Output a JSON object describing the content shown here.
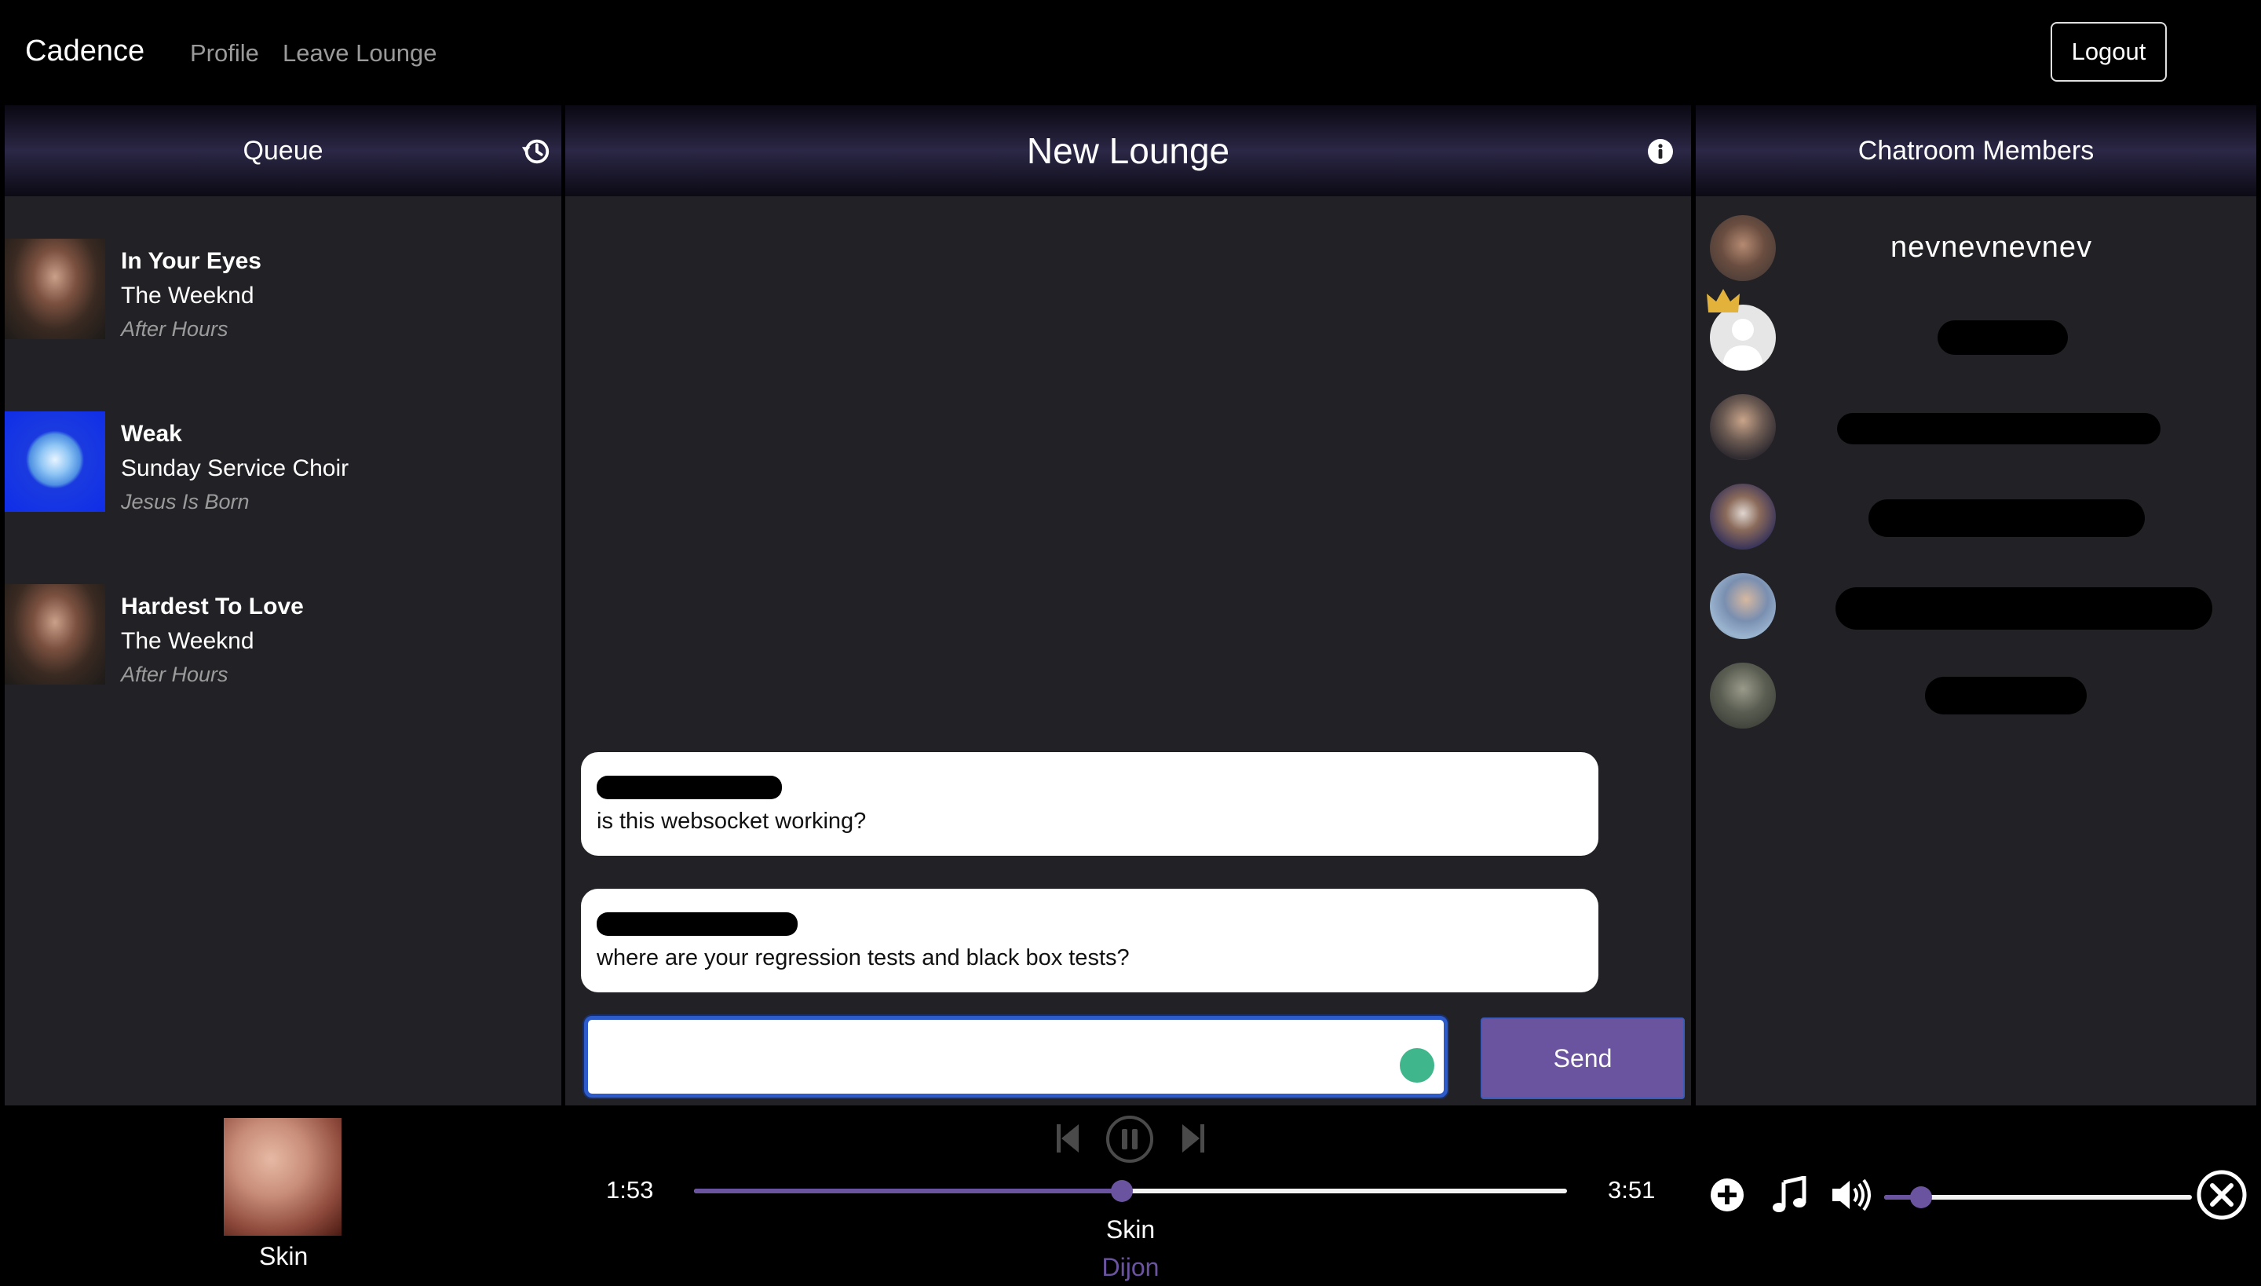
{
  "nav": {
    "brand": "Cadence",
    "profile": "Profile",
    "leave_lounge": "Leave Lounge",
    "logout": "Logout"
  },
  "queue": {
    "title": "Queue",
    "history_icon": "history-icon",
    "items": [
      {
        "title": "In Your Eyes",
        "artist": "The Weeknd",
        "album": "After Hours"
      },
      {
        "title": "Weak",
        "artist": "Sunday Service Choir",
        "album": "Jesus Is Born"
      },
      {
        "title": "Hardest To Love",
        "artist": "The Weeknd",
        "album": "After Hours"
      }
    ]
  },
  "lounge": {
    "title": "New Lounge",
    "info_icon": "info-icon",
    "messages": [
      {
        "text": "is this websocket working?"
      },
      {
        "text": "where are your regression tests and black box tests?"
      }
    ],
    "input_value": "",
    "send_label": "Send"
  },
  "members": {
    "title": "Chatroom Members",
    "visible_name": "nevnevnevnev"
  },
  "player": {
    "album_title": "Skin",
    "elapsed": "1:53",
    "duration": "3:51",
    "progress_fraction": 0.49,
    "volume_fraction": 0.12,
    "track_title": "Skin",
    "track_artist": "Dijon"
  },
  "colors": {
    "accent": "#6b549f",
    "panel_bg": "#222126",
    "input_border": "#2d5bc9"
  }
}
